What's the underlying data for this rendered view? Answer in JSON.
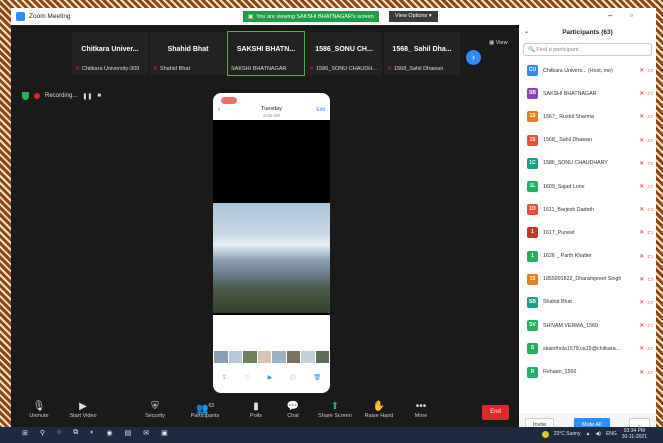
{
  "window": {
    "title": "Zoom Meeting",
    "share_banner": "You are viewing SAKSHI BHATNAGAR's screen",
    "view_options": "View Options ▾",
    "view": "View"
  },
  "thumbnails": [
    {
      "name": "Chitkara Univer...",
      "sub": "Chitkara University-309"
    },
    {
      "name": "Shahid Bhat",
      "sub": "Shahid Bhat"
    },
    {
      "name": "SAKSHI BHATN...",
      "sub": "SAKSHI BHATNAGAR"
    },
    {
      "name": "1586_SONU CH...",
      "sub": "1586_SONU CHAUDH..."
    },
    {
      "name": "1568_ Sahil Dha...",
      "sub": "1568_Sahil Dhawan"
    }
  ],
  "recording": {
    "label": "Recording..."
  },
  "phone": {
    "date": "Tuesday",
    "time": "9:05 AM",
    "edit": "Edit"
  },
  "toolbar": {
    "unmute": "Unmute",
    "start_video": "Start Video",
    "security": "Security",
    "participants": "Participants",
    "participants_count": "63",
    "polls": "Polls",
    "chat": "Chat",
    "share_screen": "Share Screen",
    "raise_hand": "Raise Hand",
    "more": "More",
    "end": "End"
  },
  "panel": {
    "title": "Participants (63)",
    "search_placeholder": "Find a participant",
    "participants": [
      {
        "initials": "CU",
        "name": "Chitkara Univers... (Host, me)",
        "color": "#2d8cff"
      },
      {
        "initials": "SB",
        "name": "SAKSHI BHATNAGAR",
        "color": "#8e44ad"
      },
      {
        "initials": "1S",
        "name": "1567_ Rushil Sharma",
        "color": "#e67e22"
      },
      {
        "initials": "1S",
        "name": "1568_ Sahil Dhawan",
        "color": "#e74c3c"
      },
      {
        "initials": "1C",
        "name": "1586_SONU CHAUDHARY",
        "color": "#16a085"
      },
      {
        "initials": "1L",
        "name": "1609_Sajad Lone",
        "color": "#27ae60"
      },
      {
        "initials": "1D",
        "name": "1611_Barjesh Dadeth",
        "color": "#e74c3c"
      },
      {
        "initials": "1",
        "name": "1617_Puneet",
        "color": "#c0392b"
      },
      {
        "initials": "1",
        "name": "1626 _ Parth Khatter",
        "color": "#27ae60"
      },
      {
        "initials": "1S",
        "name": "1855991822_Dharampreet Singh",
        "color": "#e67e22"
      },
      {
        "initials": "SB",
        "name": "Shahid Bhat",
        "color": "#16a085"
      },
      {
        "initials": "SV",
        "name": "SHIVAM VERMA_1560",
        "color": "#27ae60"
      },
      {
        "initials": "S",
        "name": "skainthola1579.ca19@chitkara...",
        "color": "#27ae60"
      },
      {
        "initials": "R",
        "name": "Rehaan_1566",
        "color": "#27ae60"
      }
    ],
    "invite": "Invite",
    "mute_all": "Mute All",
    "more": "..."
  },
  "taskbar": {
    "weather": "23°C Sunny",
    "lang": "ENG",
    "time": "03:34 PM",
    "date": "30-11-2021"
  }
}
